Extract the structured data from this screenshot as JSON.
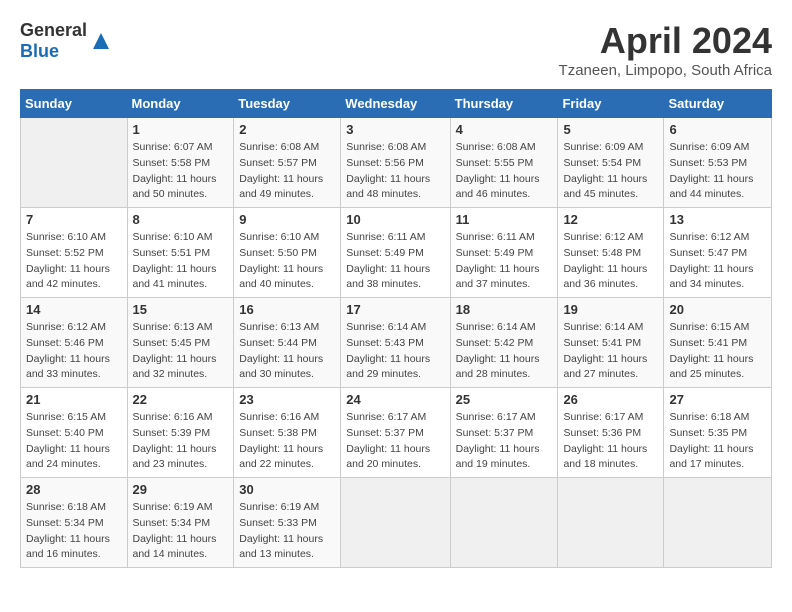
{
  "header": {
    "logo_general": "General",
    "logo_blue": "Blue",
    "month_year": "April 2024",
    "location": "Tzaneen, Limpopo, South Africa"
  },
  "calendar": {
    "weekdays": [
      "Sunday",
      "Monday",
      "Tuesday",
      "Wednesday",
      "Thursday",
      "Friday",
      "Saturday"
    ],
    "weeks": [
      [
        {
          "day": "",
          "info": ""
        },
        {
          "day": "1",
          "info": "Sunrise: 6:07 AM\nSunset: 5:58 PM\nDaylight: 11 hours\nand 50 minutes."
        },
        {
          "day": "2",
          "info": "Sunrise: 6:08 AM\nSunset: 5:57 PM\nDaylight: 11 hours\nand 49 minutes."
        },
        {
          "day": "3",
          "info": "Sunrise: 6:08 AM\nSunset: 5:56 PM\nDaylight: 11 hours\nand 48 minutes."
        },
        {
          "day": "4",
          "info": "Sunrise: 6:08 AM\nSunset: 5:55 PM\nDaylight: 11 hours\nand 46 minutes."
        },
        {
          "day": "5",
          "info": "Sunrise: 6:09 AM\nSunset: 5:54 PM\nDaylight: 11 hours\nand 45 minutes."
        },
        {
          "day": "6",
          "info": "Sunrise: 6:09 AM\nSunset: 5:53 PM\nDaylight: 11 hours\nand 44 minutes."
        }
      ],
      [
        {
          "day": "7",
          "info": "Sunrise: 6:10 AM\nSunset: 5:52 PM\nDaylight: 11 hours\nand 42 minutes."
        },
        {
          "day": "8",
          "info": "Sunrise: 6:10 AM\nSunset: 5:51 PM\nDaylight: 11 hours\nand 41 minutes."
        },
        {
          "day": "9",
          "info": "Sunrise: 6:10 AM\nSunset: 5:50 PM\nDaylight: 11 hours\nand 40 minutes."
        },
        {
          "day": "10",
          "info": "Sunrise: 6:11 AM\nSunset: 5:49 PM\nDaylight: 11 hours\nand 38 minutes."
        },
        {
          "day": "11",
          "info": "Sunrise: 6:11 AM\nSunset: 5:49 PM\nDaylight: 11 hours\nand 37 minutes."
        },
        {
          "day": "12",
          "info": "Sunrise: 6:12 AM\nSunset: 5:48 PM\nDaylight: 11 hours\nand 36 minutes."
        },
        {
          "day": "13",
          "info": "Sunrise: 6:12 AM\nSunset: 5:47 PM\nDaylight: 11 hours\nand 34 minutes."
        }
      ],
      [
        {
          "day": "14",
          "info": "Sunrise: 6:12 AM\nSunset: 5:46 PM\nDaylight: 11 hours\nand 33 minutes."
        },
        {
          "day": "15",
          "info": "Sunrise: 6:13 AM\nSunset: 5:45 PM\nDaylight: 11 hours\nand 32 minutes."
        },
        {
          "day": "16",
          "info": "Sunrise: 6:13 AM\nSunset: 5:44 PM\nDaylight: 11 hours\nand 30 minutes."
        },
        {
          "day": "17",
          "info": "Sunrise: 6:14 AM\nSunset: 5:43 PM\nDaylight: 11 hours\nand 29 minutes."
        },
        {
          "day": "18",
          "info": "Sunrise: 6:14 AM\nSunset: 5:42 PM\nDaylight: 11 hours\nand 28 minutes."
        },
        {
          "day": "19",
          "info": "Sunrise: 6:14 AM\nSunset: 5:41 PM\nDaylight: 11 hours\nand 27 minutes."
        },
        {
          "day": "20",
          "info": "Sunrise: 6:15 AM\nSunset: 5:41 PM\nDaylight: 11 hours\nand 25 minutes."
        }
      ],
      [
        {
          "day": "21",
          "info": "Sunrise: 6:15 AM\nSunset: 5:40 PM\nDaylight: 11 hours\nand 24 minutes."
        },
        {
          "day": "22",
          "info": "Sunrise: 6:16 AM\nSunset: 5:39 PM\nDaylight: 11 hours\nand 23 minutes."
        },
        {
          "day": "23",
          "info": "Sunrise: 6:16 AM\nSunset: 5:38 PM\nDaylight: 11 hours\nand 22 minutes."
        },
        {
          "day": "24",
          "info": "Sunrise: 6:17 AM\nSunset: 5:37 PM\nDaylight: 11 hours\nand 20 minutes."
        },
        {
          "day": "25",
          "info": "Sunrise: 6:17 AM\nSunset: 5:37 PM\nDaylight: 11 hours\nand 19 minutes."
        },
        {
          "day": "26",
          "info": "Sunrise: 6:17 AM\nSunset: 5:36 PM\nDaylight: 11 hours\nand 18 minutes."
        },
        {
          "day": "27",
          "info": "Sunrise: 6:18 AM\nSunset: 5:35 PM\nDaylight: 11 hours\nand 17 minutes."
        }
      ],
      [
        {
          "day": "28",
          "info": "Sunrise: 6:18 AM\nSunset: 5:34 PM\nDaylight: 11 hours\nand 16 minutes."
        },
        {
          "day": "29",
          "info": "Sunrise: 6:19 AM\nSunset: 5:34 PM\nDaylight: 11 hours\nand 14 minutes."
        },
        {
          "day": "30",
          "info": "Sunrise: 6:19 AM\nSunset: 5:33 PM\nDaylight: 11 hours\nand 13 minutes."
        },
        {
          "day": "",
          "info": ""
        },
        {
          "day": "",
          "info": ""
        },
        {
          "day": "",
          "info": ""
        },
        {
          "day": "",
          "info": ""
        }
      ]
    ]
  }
}
